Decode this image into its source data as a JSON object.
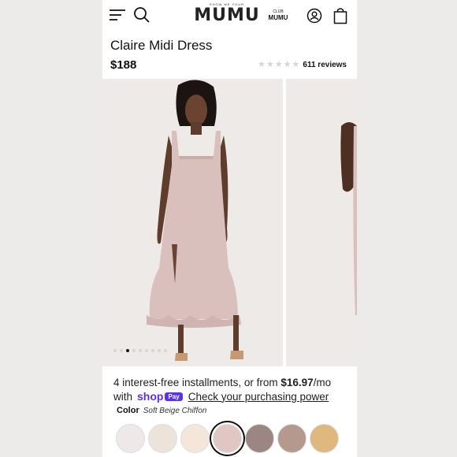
{
  "header": {
    "brand_tagline": "SHOW ME YOUR",
    "brand_name": "MUMU",
    "club_top": "CLUB",
    "club_bottom": "MUMU"
  },
  "product": {
    "title": "Claire Midi Dress",
    "price": "$188",
    "rating": 4.5,
    "reviews": "611 reviews"
  },
  "gallery": {
    "dot_count": 9,
    "active_index": 2
  },
  "installments": {
    "prefix": "4 interest-free installments, or from ",
    "amount": "$16.97",
    "suffix": "/mo",
    "with_label": "with",
    "shop_label": "shop",
    "pay_badge": "Pay",
    "link_label": "Check your purchasing power"
  },
  "color": {
    "label": "Color",
    "value": "Soft Beige Chiffon"
  },
  "swatches": [
    "#efe8e8",
    "#ece3da",
    "#f5e6da",
    "#e0c7c3",
    "#9c8681",
    "#b5998c",
    "#dfb880"
  ],
  "selected_swatch": 3,
  "colors": {
    "accent_shop": "#5a31f4",
    "star_color": "#d8d3d4"
  }
}
